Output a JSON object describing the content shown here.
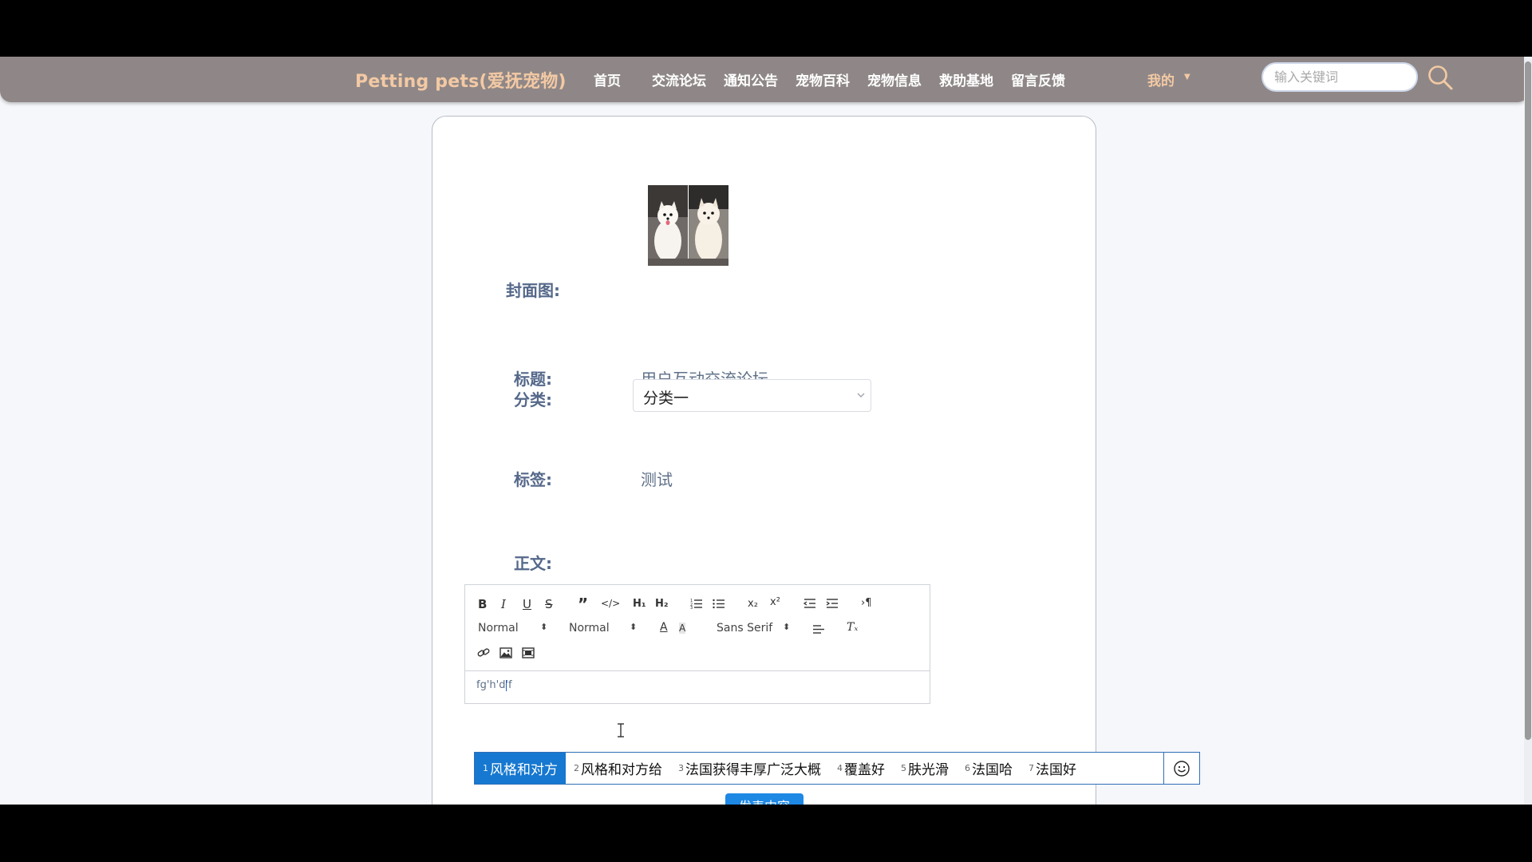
{
  "header": {
    "brand": "Petting pets(爱抚宠物)",
    "nav": [
      "首页",
      "交流论坛",
      "通知公告",
      "宠物百科",
      "宠物信息",
      "救助基地",
      "留言反馈"
    ],
    "me_label": "我的",
    "search_placeholder": "输入关键词"
  },
  "form": {
    "cover_label": "封面图:",
    "title_label": "标题:",
    "title_value": "用户互动交流论坛",
    "category_label": "分类:",
    "category_value": "分类一",
    "tag_label": "标签:",
    "tag_value": "测试",
    "body_label": "正文:",
    "editor": {
      "header_select": "Normal",
      "size_select": "Normal",
      "font_select": "Sans Serif",
      "content": "fg'h'd'f"
    },
    "submit_label": "发表内容"
  },
  "ime": {
    "candidates": [
      {
        "num": "1",
        "text": "风格和对方"
      },
      {
        "num": "2",
        "text": "风格和对方给"
      },
      {
        "num": "3",
        "text": "法国获得丰厚广泛大概"
      },
      {
        "num": "4",
        "text": "覆盖好"
      },
      {
        "num": "5",
        "text": "肤光滑"
      },
      {
        "num": "6",
        "text": "法国哈"
      },
      {
        "num": "7",
        "text": "法国好"
      }
    ]
  },
  "colors": {
    "navbar": "#8f8787",
    "brand": "#f3c9a4",
    "label": "#55688a",
    "primary_button": "#1e88e5",
    "ime_active": "#1678d0"
  }
}
